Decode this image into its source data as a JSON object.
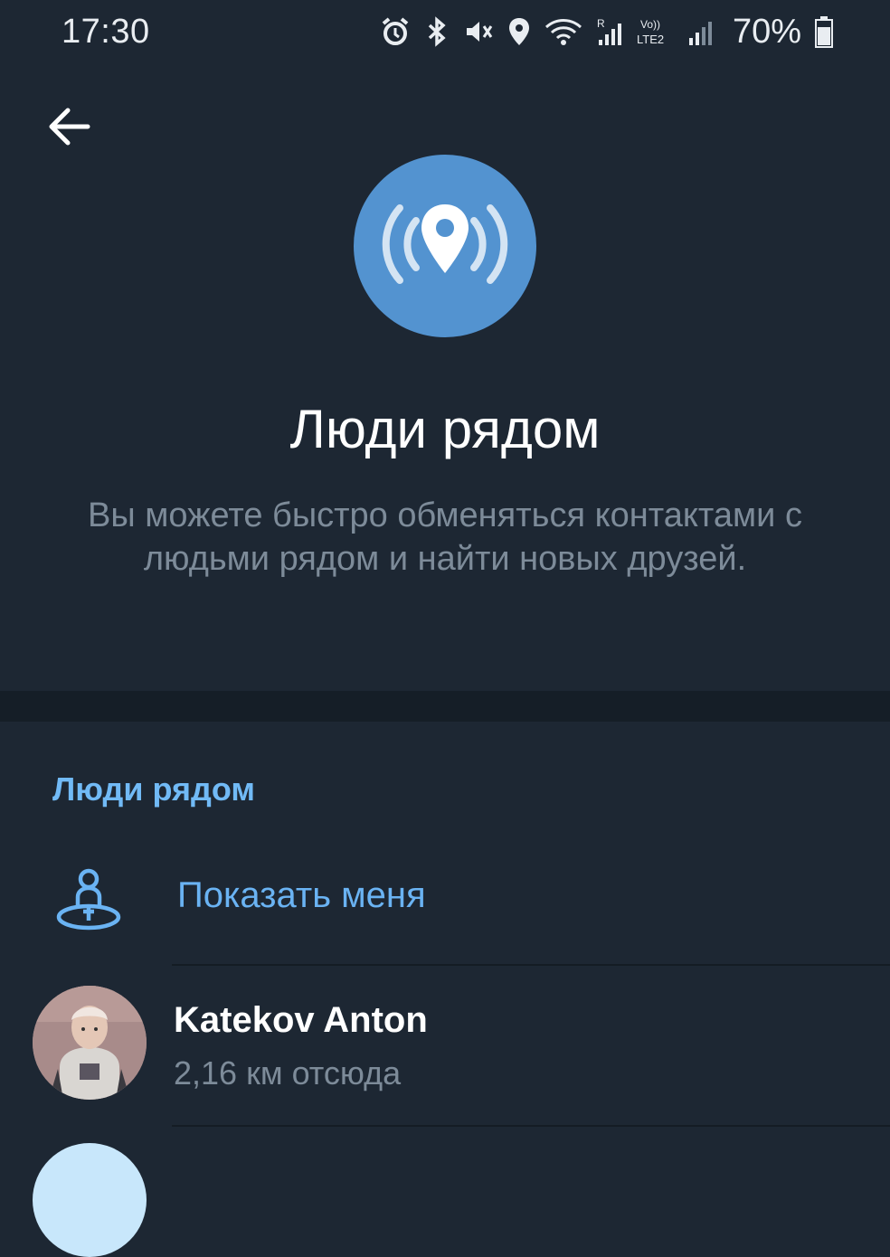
{
  "status_bar": {
    "time": "17:30",
    "battery_percent": "70%",
    "icons": [
      "alarm-icon",
      "bluetooth-icon",
      "mute-icon",
      "location-icon",
      "wifi-icon",
      "signal-r-icon",
      "volte-lte2-icon",
      "signal-icon",
      "battery-icon"
    ]
  },
  "header": {
    "back_icon": "arrow-left-icon",
    "hero_icon": "location-broadcast-icon",
    "title": "Люди рядом",
    "subtitle": "Вы можете быстро обменяться контактами с людьми рядом и найти новых друзей."
  },
  "section": {
    "title": "Люди рядом",
    "show_me": {
      "icon": "person-pin-icon",
      "label": "Показать меня"
    },
    "people": [
      {
        "name": "Katekov Anton",
        "distance": "2,16 км отсюда"
      }
    ]
  },
  "colors": {
    "background": "#1d2733",
    "divider": "#151e27",
    "accent": "#6ab3f3",
    "hero_circle": "#5393d0",
    "secondary_text": "#7d8b99"
  }
}
